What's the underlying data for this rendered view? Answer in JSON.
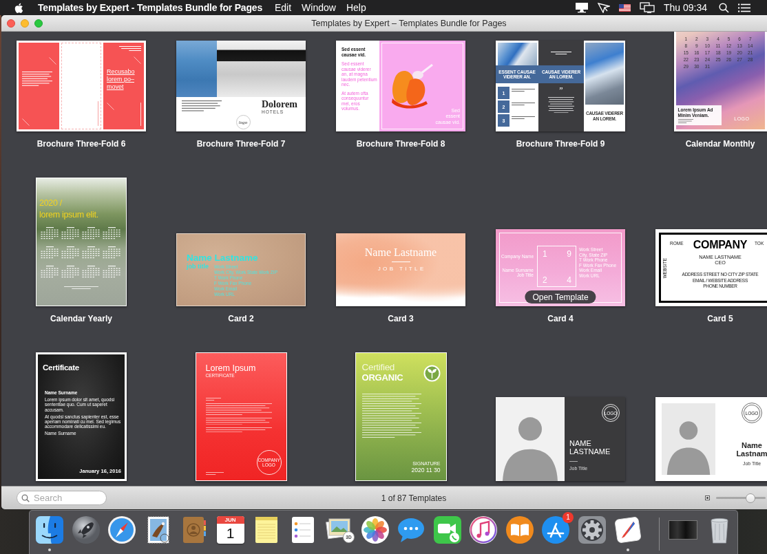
{
  "menu_bar": {
    "app_name": "Templates by Expert - Templates Bundle for Pages",
    "menus": [
      "Edit",
      "Window",
      "Help"
    ],
    "clock": "Thu 09:34"
  },
  "window": {
    "title": "Templates by Expert – Templates Bundle for Pages",
    "templates": [
      {
        "kind": "brochure-red",
        "name": "Brochure Three-Fold 6",
        "headline": [
          "Recusabo",
          "lorem po–",
          "movet"
        ]
      },
      {
        "kind": "brochure-hotel",
        "name": "Brochure Three-Fold 7",
        "title": "Dolorem",
        "subtitle": "HOTELS",
        "logo": "logo"
      },
      {
        "kind": "brochure-pink",
        "name": "Brochure Three-Fold 8",
        "heading": [
          "Sed essent",
          "causae vid."
        ],
        "paragraphs": [
          "Sed essent causae viderer an, at magna laudem petentium nec.",
          "At autem ofta consequuntur mel, eros volumus."
        ],
        "caption": [
          "Sed",
          "essent",
          "causae vid."
        ]
      },
      {
        "kind": "brochure-blue",
        "name": "Brochure Three-Fold 9",
        "band": [
          "ESSENT CAUSAE VIDERER AN.",
          "CAUSAE VIDERER AN LOREM."
        ],
        "steps": [
          "1",
          "2",
          "3"
        ],
        "quote": "”",
        "closing": "CAUSAE VIDERER AN LOREM."
      },
      {
        "kind": "calendar-month",
        "name": "Calendar Monthly",
        "days": [
          "1",
          "2",
          "3",
          "4",
          "5",
          "6",
          "7",
          "8",
          "9",
          "10",
          "11",
          "12",
          "13",
          "14",
          "15",
          "16",
          "17",
          "18",
          "19",
          "20",
          "21",
          "22",
          "23",
          "24",
          "25",
          "26",
          "27",
          "28",
          "29",
          "30",
          "31"
        ],
        "heading": "Lorem Ipsum Ad Minim Veniam.",
        "logo": "LOGO"
      },
      {
        "kind": "calendar-year",
        "name": "Calendar Yearly",
        "headline": [
          "2020 /",
          "lorem ipsum elit."
        ]
      },
      {
        "kind": "card-kraft",
        "name": "Card 2",
        "person": "Name Lastname",
        "role": "job title",
        "details": [
          "Work Street",
          "Work City, Work State Work ZIP",
          "T Work Phone",
          "F Work Fax Phone",
          "Work Email",
          "Work URL"
        ]
      },
      {
        "kind": "card-watercolor",
        "name": "Card 3",
        "person": "Name Lastname",
        "role": "JOB TITLE"
      },
      {
        "kind": "card-pink",
        "name": "Card 4",
        "company": "Company Name",
        "person": "Name Surname",
        "role": "Job Title",
        "digits": [
          "1",
          "9",
          "2",
          "4"
        ],
        "details": [
          "Work Street",
          "City, State ZIP",
          "T Work Phone",
          "F Work Fax Phone",
          "Work Email",
          "Work URL"
        ],
        "hover_button": "Open Template"
      },
      {
        "kind": "card-company",
        "name": "Card 5",
        "cities": [
          "ROME",
          "TOK"
        ],
        "company": "COMPANY",
        "side_label": "WEBSITE",
        "person": "NAME LASTNAME",
        "role": "CEO",
        "details": [
          "ADDRESS STREET NO CITY ZIP STATE",
          "EMAIL / WEBSITE ADDRESS",
          "PHONE NUMBER"
        ]
      },
      {
        "kind": "certificate-dark",
        "title": "Certificate",
        "recipient": "Name Surname",
        "paragraphs": [
          "Lorem ipsum dolor sit amet, quodsi sententiae quo. Cum ut saperet accusam.",
          "At quodsi sanctus sapienter est, esse aperiam nominati cu mei. Sed legimus accommodare delicatissimi eu."
        ],
        "signer": "Name Surname",
        "date": "January 16, 2016"
      },
      {
        "kind": "certificate-red",
        "title": "Lorem Ipsum",
        "subtitle": "CERTIFICATE",
        "logo": "COMPANY LOGO"
      },
      {
        "kind": "certificate-organic",
        "title": "Certified",
        "subtitle": "ORGANIC",
        "signature": "SIGNATURE",
        "date": "2020 11 30"
      },
      {
        "kind": "id-dark",
        "logo": "LOGO",
        "person": [
          "NAME",
          "LASTNAME"
        ],
        "role": "Job Title"
      },
      {
        "kind": "id-light",
        "logo": "LOGO",
        "person": [
          "Name",
          "Lastnam"
        ],
        "role": "Job Title"
      }
    ],
    "search": {
      "placeholder": "Search"
    },
    "status": "1 of 87 Templates",
    "thumbnail_size": {
      "level": 0.7
    }
  },
  "dock": {
    "apps": [
      {
        "kind": "finder",
        "running": true
      },
      {
        "kind": "launchpad",
        "running": false
      },
      {
        "kind": "safari",
        "running": false
      },
      {
        "kind": "mail",
        "running": false
      },
      {
        "kind": "contacts",
        "running": false
      },
      {
        "kind": "calendar",
        "running": false,
        "month": "JUN",
        "day": "1"
      },
      {
        "kind": "notes",
        "running": false
      },
      {
        "kind": "reminders",
        "running": false
      },
      {
        "kind": "photo-3d",
        "running": false,
        "emblem": "3D"
      },
      {
        "kind": "photos",
        "running": false
      },
      {
        "kind": "messages",
        "running": false
      },
      {
        "kind": "facetime",
        "running": false
      },
      {
        "kind": "music",
        "running": false
      },
      {
        "kind": "books",
        "running": false
      },
      {
        "kind": "app-store",
        "running": false,
        "badge": "1"
      },
      {
        "kind": "settings",
        "running": false
      },
      {
        "kind": "pen-app",
        "running": true
      },
      {
        "kind": "divider"
      },
      {
        "kind": "window-preview",
        "running": false
      },
      {
        "kind": "trash",
        "running": false
      }
    ]
  }
}
